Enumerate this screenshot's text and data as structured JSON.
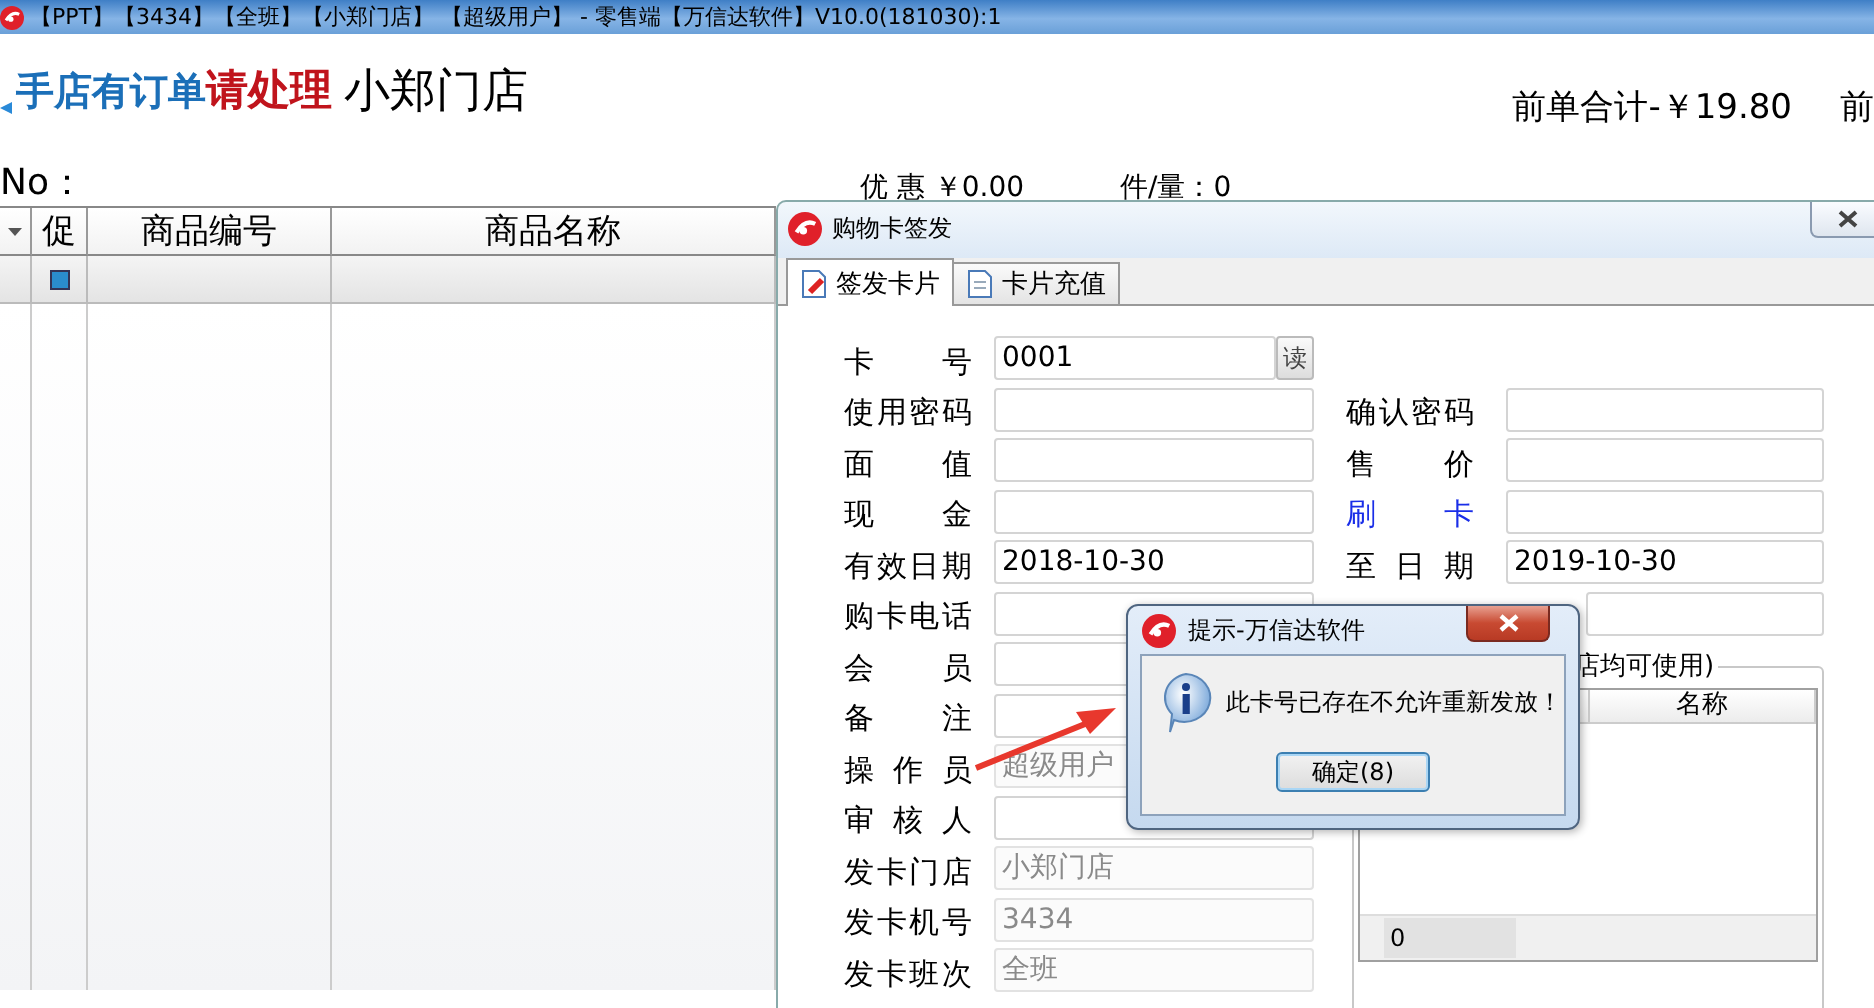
{
  "window": {
    "title": "【PPT】【3434】【全班】【小郑门店】 【超级用户】 - 零售端【万信达软件】V10.0(181030):1"
  },
  "header": {
    "logo": [
      {
        "text": "手店有订单",
        "kind": "blue"
      },
      {
        "text": "请处理",
        "kind": "red"
      }
    ],
    "store_name": "小郑门店",
    "previous_total": "前单合计-￥19.80",
    "next_label": "前"
  },
  "summary": {
    "order_no": "No：",
    "discount": "优 惠 ￥0.00",
    "quantity": "件/量：0"
  },
  "grid": {
    "columns": [
      "促",
      "商品编号",
      "商品名称"
    ]
  },
  "card_dialog": {
    "title": "购物卡签发",
    "tabs": [
      {
        "label": "签发卡片",
        "selected": true
      },
      {
        "label": "卡片充值",
        "selected": false
      }
    ],
    "left_fields": [
      {
        "label": "卡 号",
        "value": "0001",
        "disabled": false,
        "button": "读"
      },
      {
        "label": "使用密码",
        "disabled": false
      },
      {
        "label": "面 值",
        "disabled": false
      },
      {
        "label": "现 金",
        "disabled": false
      },
      {
        "label": "有效日期",
        "value": "2018-10-30",
        "disabled": false
      },
      {
        "label": "购卡电话",
        "disabled": false
      },
      {
        "label": "会 员",
        "disabled": false
      },
      {
        "label": "备 注",
        "disabled": false
      },
      {
        "label": "操 作 员",
        "value": "超级用户",
        "disabled": true
      },
      {
        "label": "审 核 人",
        "disabled": false
      },
      {
        "label": "发卡门店",
        "value": "小郑门店",
        "disabled": true
      },
      {
        "label": "发卡机号",
        "value": "3434",
        "disabled": true
      },
      {
        "label": "发卡班次",
        "value": "全班",
        "disabled": true
      }
    ],
    "right_fields": [
      {
        "label": "确认密码",
        "kind": "plain"
      },
      {
        "label": "售 价",
        "kind": "plain"
      },
      {
        "label": "刷 卡",
        "kind": "link"
      },
      {
        "label": "至 日 期",
        "value": "2019-10-30",
        "kind": "plain"
      },
      {
        "kind": "bare"
      }
    ],
    "store_group": {
      "title": "店均可使用)",
      "name_column": "名称",
      "footer_value": "0"
    }
  },
  "message_box": {
    "title": "提示-万信达软件",
    "message": "此卡号已存在不允许重新发放！",
    "button": "确定(8)"
  }
}
